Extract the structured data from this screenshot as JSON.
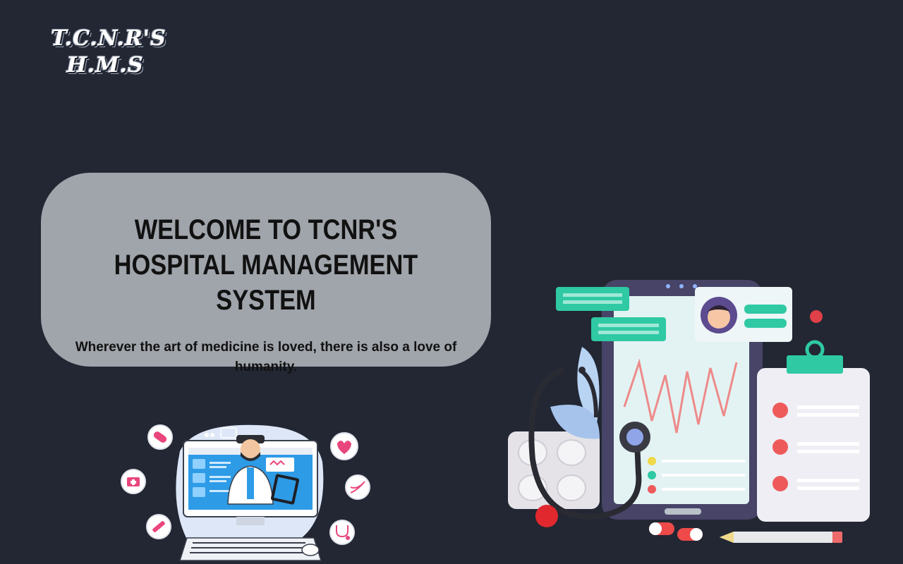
{
  "header": {
    "logo_line1": "T.C.N.R'S",
    "logo_line2": "H.M.S"
  },
  "hero": {
    "title": "WELCOME TO TCNR'S HOSPITAL MANAGEMENT SYSTEM",
    "quote": "Wherever the art of medicine is loved, there is also a love of humanity."
  },
  "colors": {
    "background": "#222733",
    "card": "#a0a4ab",
    "accent_teal": "#2fc9a4",
    "accent_pink": "#e8467c"
  },
  "icons": [
    "pill-icon",
    "first-aid-kit-icon",
    "syringe-icon",
    "heart-monitor-icon",
    "dna-icon",
    "stethoscope-icon",
    "clipboard-icon"
  ]
}
